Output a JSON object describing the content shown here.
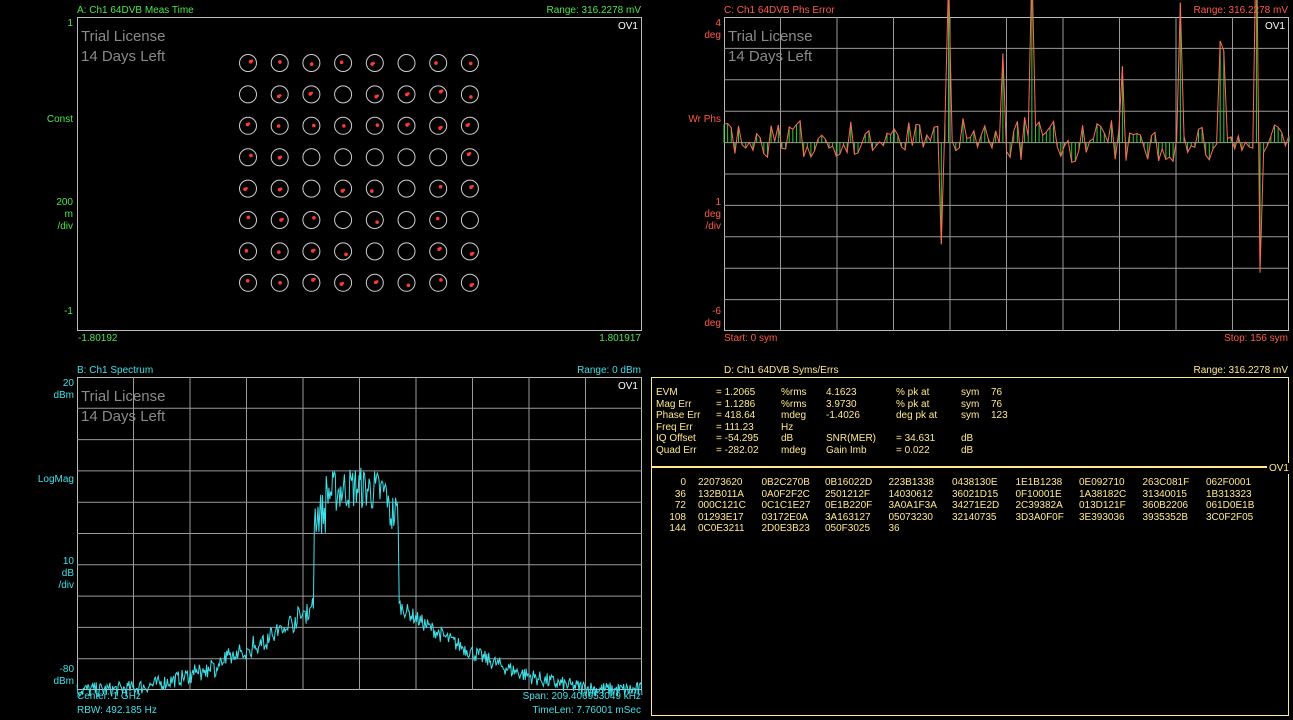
{
  "colors": {
    "green": "#4ce64c",
    "red": "#ff5a4a",
    "cyan": "#3fe0e8",
    "yellow": "#ffe98a",
    "grid": "#bbbbbb"
  },
  "watermark": {
    "line1": "Trial License",
    "line2": "14 Days Left"
  },
  "overload": "OV1",
  "paneA": {
    "title": "A: Ch1 64DVB Meas Time",
    "range": "Range: 316.2278 mV",
    "y_top": "1",
    "y_mid": "Const",
    "y_scale1": "200",
    "y_scale2": "m",
    "y_scale3": "/div",
    "y_bottom": "-1",
    "x_left": "-1.80192",
    "x_right": "1.801917",
    "constellation_size": 8
  },
  "paneC": {
    "title": "C: Ch1 64DVB Phs Error",
    "range": "Range: 316.2278 mV",
    "y_top1": "4",
    "y_top2": "deg",
    "y_mid": "Wr Phs",
    "y_scale1": "1",
    "y_scale2": "deg",
    "y_scale3": "/div",
    "y_bot1": "-6",
    "y_bot2": "deg",
    "x_start": "Start: 0  sym",
    "x_stop": "Stop: 156  sym"
  },
  "paneB": {
    "title": "B: Ch1 Spectrum",
    "range": "Range: 0 dBm",
    "y_top1": "20",
    "y_top2": "dBm",
    "y_mid": "LogMag",
    "y_scale1": "10",
    "y_scale2": "dB",
    "y_scale3": "/div",
    "y_bot1": "-80",
    "y_bot2": "dBm",
    "center": "Center: 1 GHz",
    "span": "Span: 209.406953049 kHz",
    "rbw": "RBW: 492.185  Hz",
    "timelen": "TimeLen: 7.76001 mSec"
  },
  "paneD": {
    "title": "D: Ch1 64DVB Syms/Errs",
    "range": "Range: 316.2278 mV",
    "metrics": [
      [
        "EVM",
        "= 1.2065",
        "%rms",
        "4.1623",
        "% pk  at",
        "sym",
        "76"
      ],
      [
        "Mag Err",
        "= 1.1286",
        "%rms",
        "3.9730",
        "% pk  at",
        "sym",
        "76"
      ],
      [
        "Phase Err",
        "= 418.64",
        "mdeg",
        "-1.4026",
        "deg  pk  at",
        "sym",
        "123"
      ],
      [
        "Freq Err",
        "= 111.23",
        "Hz",
        "",
        "",
        "",
        ""
      ],
      [
        "IQ Offset",
        "= -54.295",
        "dB",
        "SNR(MER)",
        "= 34.631",
        "dB",
        ""
      ],
      [
        "Quad Err",
        "= -282.02",
        "mdeg",
        "Gain  Imb",
        "= 0.022",
        "dB",
        ""
      ]
    ],
    "symbols": [
      [
        "0",
        "22073620",
        "0B2C270B",
        "0B16022D",
        "223B1338",
        "0438130E",
        "1E1B1238",
        "0E092710",
        "263C081F",
        "062F0001"
      ],
      [
        "36",
        "132B011A",
        "0A0F2F2C",
        "2501212F",
        "14030612",
        "36021D15",
        "0F10001E",
        "1A38182C",
        "31340015",
        "1B313323"
      ],
      [
        "72",
        "000C121C",
        "0C1C1E27",
        "0E1B220F",
        "3A0A1F3A",
        "34271E2D",
        "2C39382A",
        "013D121F",
        "360B2206",
        "061D0E1B"
      ],
      [
        "108",
        "01293E17",
        "03172E0A",
        "3A163127",
        "05073230",
        "32140735",
        "3D3A0F0F",
        "3E393036",
        "3935352B",
        "3C0F2F05"
      ],
      [
        "144",
        "0C0E3211",
        "2D0E3B23",
        "050F3025",
        "36",
        "",
        "",
        "",
        "",
        ""
      ]
    ]
  }
}
